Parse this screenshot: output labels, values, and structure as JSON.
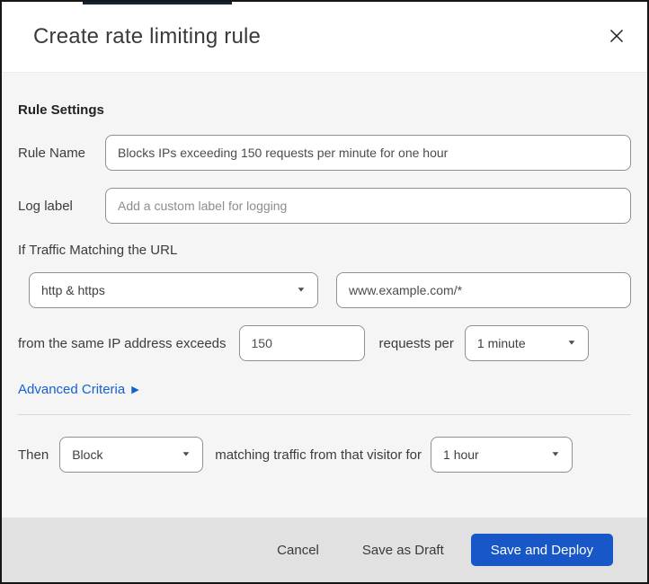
{
  "dialog": {
    "title": "Create rate limiting rule",
    "close_icon": "✕"
  },
  "rule_settings": {
    "heading": "Rule Settings",
    "rule_name_label": "Rule Name",
    "rule_name_value": "Blocks IPs exceeding 150 requests per minute for one hour",
    "log_label_label": "Log label",
    "log_label_placeholder": "Add a custom label for logging"
  },
  "match": {
    "heading": "If Traffic Matching the URL",
    "scheme_selected": "http & https",
    "url_value": "www.example.com/*",
    "threshold_prefix": "from the same IP address exceeds",
    "threshold_value": "150",
    "threshold_suffix": "requests per",
    "period_selected": "1 minute",
    "advanced_link_label": "Advanced Criteria",
    "expand_icon": "▶"
  },
  "action": {
    "then_label": "Then",
    "action_selected": "Block",
    "middle_text": "matching traffic from that visitor for",
    "duration_selected": "1 hour"
  },
  "footer": {
    "cancel_label": "Cancel",
    "save_draft_label": "Save as Draft",
    "save_deploy_label": "Save and Deploy"
  },
  "icons": {
    "chevron_down": "▼"
  },
  "colors": {
    "accent-blue": "#1757c8",
    "link-blue": "#1560d0",
    "artifact-navy": "#102437",
    "body-bg": "#f5f5f6",
    "footer-bg": "#e1e1e2",
    "input-border": "#909090"
  }
}
